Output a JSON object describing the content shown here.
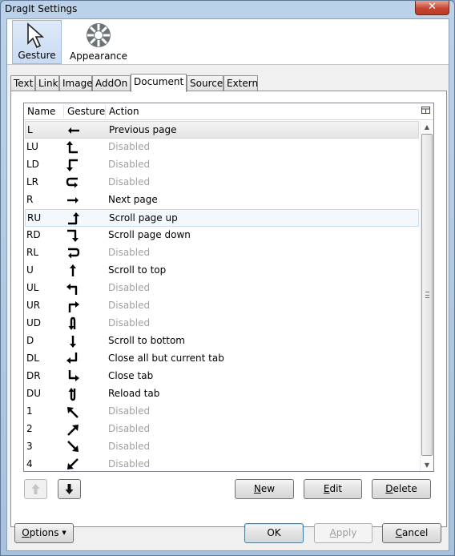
{
  "window": {
    "title": "DragIt Settings",
    "close_glyph": "✕"
  },
  "toolbar": {
    "gesture": {
      "label": "Gesture",
      "icon": "cursor-arrow-icon"
    },
    "appearance": {
      "label": "Appearance",
      "icon": "wheel-icon"
    }
  },
  "tabs": [
    "Text",
    "Link",
    "Image",
    "AddOn",
    "Document",
    "Source",
    "Extern"
  ],
  "selected_tab": "Document",
  "list": {
    "headers": {
      "name": "Name",
      "gesture": "Gesture",
      "action": "Action"
    },
    "rows": [
      {
        "name": "L",
        "action": "Previous page",
        "disabled": false,
        "icon": "arrow-left-icon"
      },
      {
        "name": "LU",
        "action": "Disabled",
        "disabled": true,
        "icon": "arrow-left-up-icon"
      },
      {
        "name": "LD",
        "action": "Disabled",
        "disabled": true,
        "icon": "arrow-left-down-icon"
      },
      {
        "name": "LR",
        "action": "Disabled",
        "disabled": true,
        "icon": "arrow-left-right-icon"
      },
      {
        "name": "R",
        "action": "Next page",
        "disabled": false,
        "icon": "arrow-right-icon"
      },
      {
        "name": "RU",
        "action": "Scroll page up",
        "disabled": false,
        "icon": "arrow-right-up-icon"
      },
      {
        "name": "RD",
        "action": "Scroll page down",
        "disabled": false,
        "icon": "arrow-right-down-icon"
      },
      {
        "name": "RL",
        "action": "Disabled",
        "disabled": true,
        "icon": "arrow-right-left-icon"
      },
      {
        "name": "U",
        "action": "Scroll to top",
        "disabled": false,
        "icon": "arrow-up-icon"
      },
      {
        "name": "UL",
        "action": "Disabled",
        "disabled": true,
        "icon": "arrow-up-left-icon"
      },
      {
        "name": "UR",
        "action": "Disabled",
        "disabled": true,
        "icon": "arrow-up-right-icon"
      },
      {
        "name": "UD",
        "action": "Disabled",
        "disabled": true,
        "icon": "arrow-up-down-icon"
      },
      {
        "name": "D",
        "action": "Scroll to bottom",
        "disabled": false,
        "icon": "arrow-down-icon"
      },
      {
        "name": "DL",
        "action": "Close all but current tab",
        "disabled": false,
        "icon": "arrow-down-left-icon"
      },
      {
        "name": "DR",
        "action": "Close tab",
        "disabled": false,
        "icon": "arrow-down-right-icon"
      },
      {
        "name": "DU",
        "action": "Reload tab",
        "disabled": false,
        "icon": "arrow-down-up-icon"
      },
      {
        "name": "1",
        "action": "Disabled",
        "disabled": true,
        "icon": "arrow-diag-up-left-icon"
      },
      {
        "name": "2",
        "action": "Disabled",
        "disabled": true,
        "icon": "arrow-diag-up-right-icon"
      },
      {
        "name": "3",
        "action": "Disabled",
        "disabled": true,
        "icon": "arrow-diag-down-right-icon"
      },
      {
        "name": "4",
        "action": "Disabled",
        "disabled": true,
        "icon": "arrow-diag-down-left-icon"
      }
    ],
    "selected_row": "L",
    "hover_row": "RU"
  },
  "buttons": {
    "new": {
      "pre": "",
      "key": "N",
      "post": "ew"
    },
    "edit": {
      "pre": "",
      "key": "E",
      "post": "dit"
    },
    "delete": {
      "pre": "",
      "key": "D",
      "post": "elete"
    },
    "options": {
      "pre": "",
      "key": "O",
      "post": "ptions"
    },
    "ok": "OK",
    "apply": {
      "pre": "",
      "key": "A",
      "post": "pply"
    },
    "cancel": {
      "pre": "",
      "key": "C",
      "post": "ancel"
    }
  },
  "colors": {
    "selection": "#e5e5e5",
    "hover": "#f4f8fd",
    "disabled_text": "#a0a0a0"
  }
}
